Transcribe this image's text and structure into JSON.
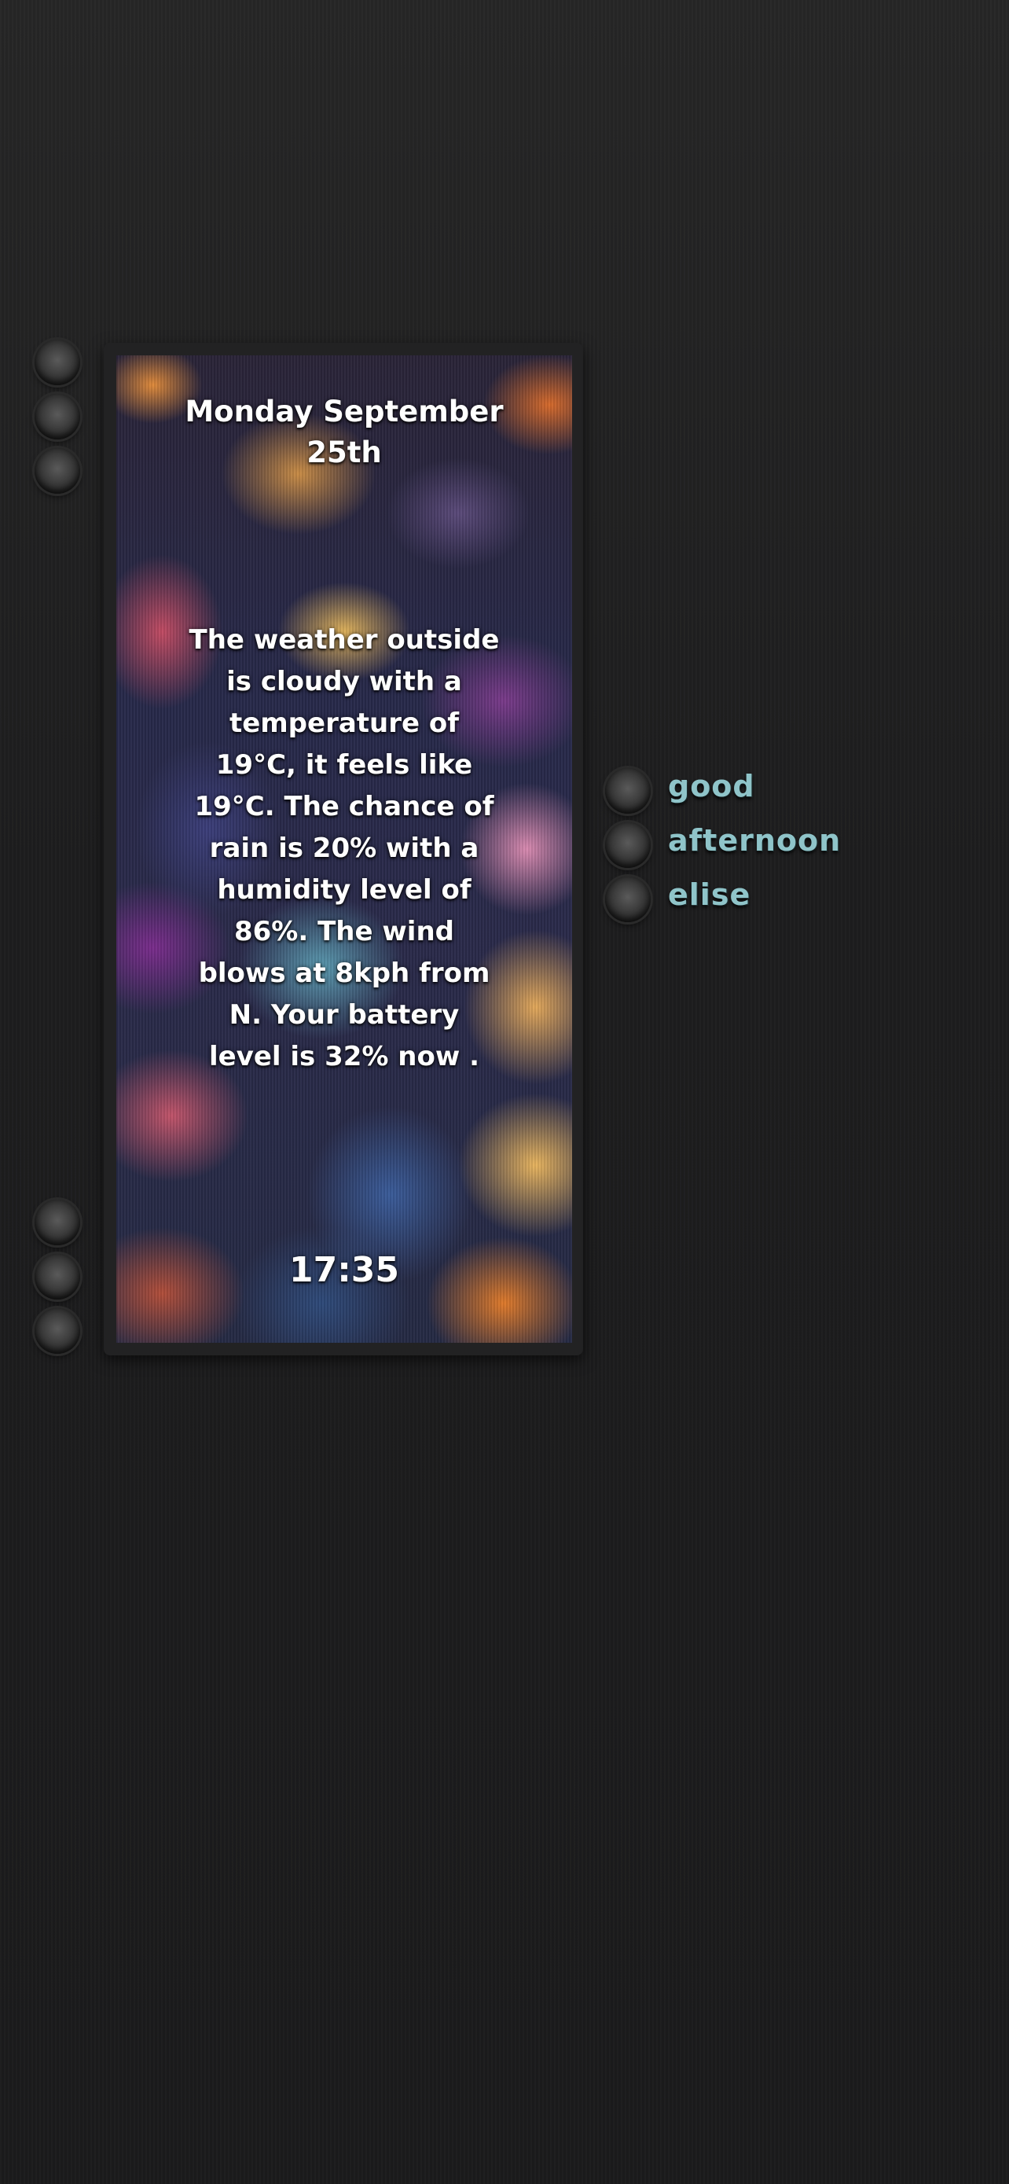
{
  "widget": {
    "date": "Monday September 25th",
    "weather_text": "The weather outside is cloudy with a temperature of 19°C, it feels like 19°C. The chance of rain is 20% with a humidity level of 86%. The wind blows at 8kph from N. Your battery level is 32% now .",
    "time": "17:35"
  },
  "greeting": {
    "line1": "good",
    "line2": "afternoon",
    "line3": "elise"
  },
  "colors": {
    "background": "#1c1c1d",
    "greeting_text": "#8fc4c9",
    "widget_text": "#ffffff"
  }
}
